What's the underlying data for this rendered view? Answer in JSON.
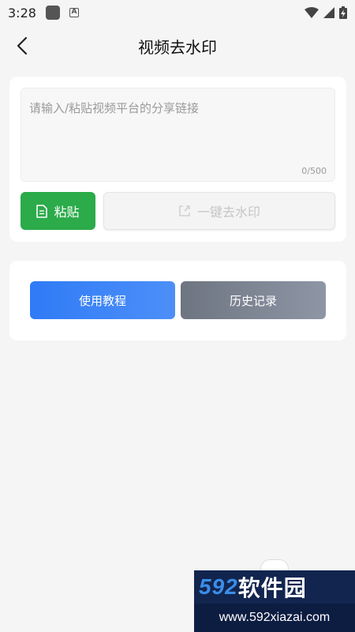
{
  "status_bar": {
    "time": "3:28",
    "a_glyph": "A",
    "icons": [
      "app-icon",
      "a-icon",
      "wifi-icon",
      "signal-icon",
      "battery-icon"
    ]
  },
  "header": {
    "title": "视频去水印",
    "back_icon": "chevron-left-icon"
  },
  "input_card": {
    "placeholder": "请输入/粘贴视频平台的分享链接",
    "value": "",
    "char_count": "0/500",
    "paste_label": "粘贴",
    "paste_icon": "document-icon",
    "remove_label": "一键去水印",
    "remove_icon": "export-icon"
  },
  "actions_card": {
    "tutorial_label": "使用教程",
    "history_label": "历史记录"
  },
  "watermark": {
    "brand_num": "592",
    "brand_text": "软件园",
    "url": "www.592xiazai.com"
  },
  "colors": {
    "paste_green": "#2bab4a",
    "tutorial_blue": "#2f7bf6",
    "history_gray": "#7a828f",
    "background": "#f5f5f5"
  }
}
